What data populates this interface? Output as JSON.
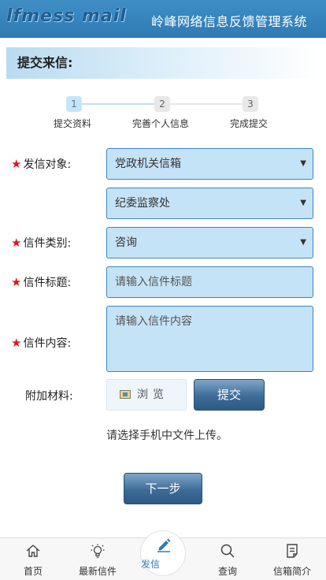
{
  "header": {
    "logo_text": "lfmess mail",
    "app_title": "岭峰网络信息反馈管理系统"
  },
  "section": {
    "title": "提交来信:"
  },
  "steps": [
    {
      "number": "1",
      "label": "提交资料"
    },
    {
      "number": "2",
      "label": "完善个人信息"
    },
    {
      "number": "3",
      "label": "完成提交"
    }
  ],
  "form": {
    "recipient": {
      "label": "发信对象:",
      "value": "党政机关信箱",
      "sub_value": "纪委监察处"
    },
    "category": {
      "label": "信件类别:",
      "value": "咨询"
    },
    "subject": {
      "label": "信件标题:",
      "placeholder": "请输入信件标题"
    },
    "content": {
      "label": "信件内容:",
      "placeholder": "请输入信件内容"
    },
    "attachment": {
      "label": "附加材料:",
      "browse_label": "浏览",
      "submit_label": "提交",
      "hint": "请选择手机中文件上传。"
    },
    "next_label": "下一步"
  },
  "nav": {
    "home": "首页",
    "latest": "最新信件",
    "write": "发信",
    "search": "查询",
    "intro": "信箱简介"
  },
  "colors": {
    "header": "#2f7ab3",
    "field_bg": "#c5e3f6",
    "field_border": "#3a86bd",
    "required": "#e0141e",
    "button": "#3d6c97"
  }
}
